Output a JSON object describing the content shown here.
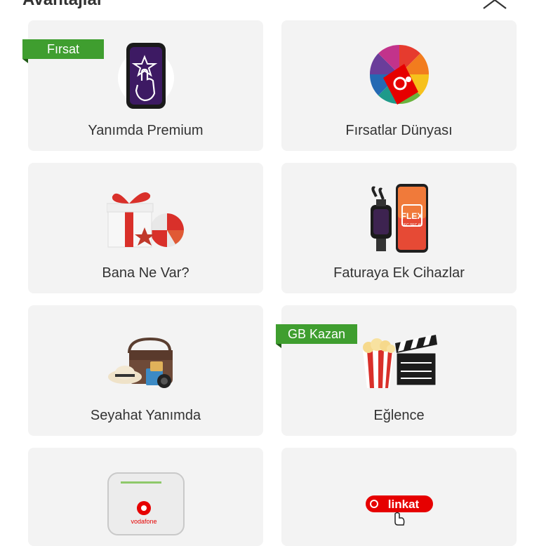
{
  "header": {
    "title": "Avantajlar"
  },
  "cards": [
    {
      "label": "Yanımda Premium",
      "badge": "Fırsat",
      "icon": "phone-star-icon"
    },
    {
      "label": "Fırsatlar Dünyası",
      "icon": "prize-wheel-tag-icon"
    },
    {
      "label": "Bana Ne Var?",
      "icon": "gift-box-beach-ball-icon"
    },
    {
      "label": "Faturaya Ek Cihazlar",
      "icon": "devices-flex-icon"
    },
    {
      "label": "Seyahat Yanımda",
      "icon": "travel-bag-hat-icon"
    },
    {
      "label": "Eğlence",
      "badge": "GB Kazan",
      "icon": "popcorn-clapper-icon"
    },
    {
      "label": "",
      "icon": "vodafone-modem-icon",
      "brand": "vodafone"
    },
    {
      "label": "",
      "icon": "linkat-logo-icon",
      "brand": "linkat"
    }
  ],
  "colors": {
    "badge": "#3f9e2f",
    "brand_red": "#e60000",
    "card_bg": "#f3f3f3"
  }
}
